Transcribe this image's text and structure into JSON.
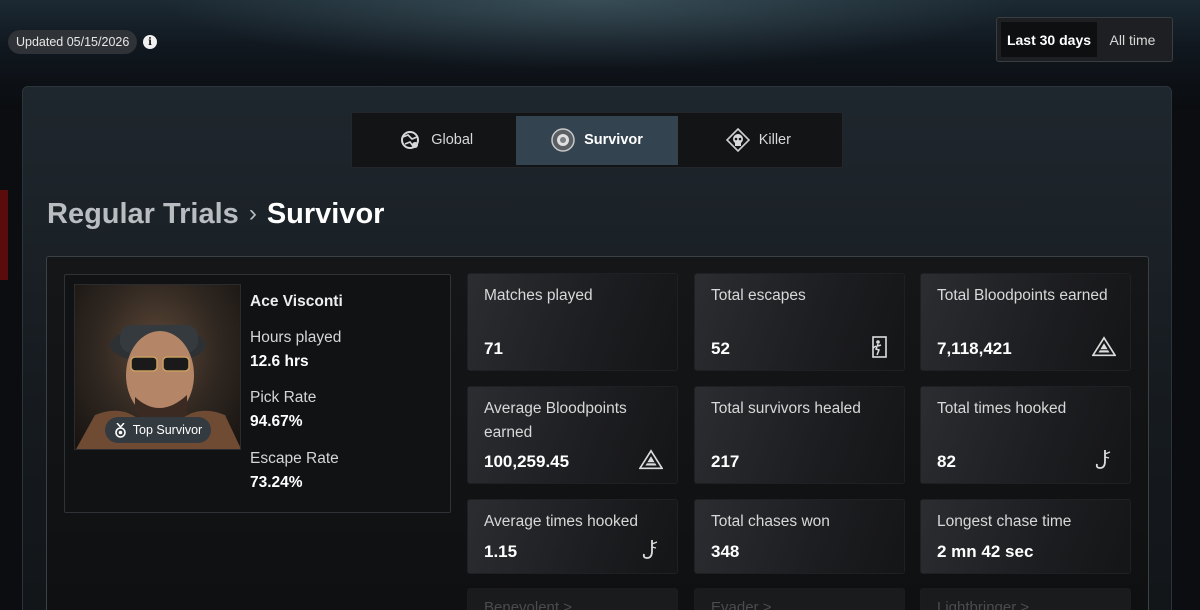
{
  "header": {
    "updated": "Updated 05/15/2026",
    "range": {
      "active": "Last 30 days",
      "inactive": "All time"
    }
  },
  "tabs": [
    {
      "label": "Global",
      "icon": "globe-map-icon"
    },
    {
      "label": "Survivor",
      "icon": "survivor-emblem-icon",
      "active": true
    },
    {
      "label": "Killer",
      "icon": "skull-icon"
    }
  ],
  "breadcrumb": {
    "parent": "Regular Trials",
    "separator": "›",
    "current": "Survivor"
  },
  "character": {
    "name": "Ace Visconti",
    "badge": "Top Survivor",
    "stats": [
      {
        "label": "Hours played",
        "value": "12.6 hrs"
      },
      {
        "label": "Pick Rate",
        "value": "94.67%"
      },
      {
        "label": "Escape Rate",
        "value": "73.24%"
      }
    ]
  },
  "stats": [
    {
      "label": "Matches played",
      "value": "71",
      "icon": ""
    },
    {
      "label": "Total escapes",
      "value": "52",
      "icon": "exit-door-icon"
    },
    {
      "label": "Total Bloodpoints earned",
      "value": "7,118,421",
      "icon": "bloodpoints-icon"
    },
    {
      "label": "Average Bloodpoints earned",
      "value": "100,259.45",
      "icon": "bloodpoints-icon"
    },
    {
      "label": "Total survivors healed",
      "value": "217",
      "icon": ""
    },
    {
      "label": "Total times hooked",
      "value": "82",
      "icon": "hook-icon"
    },
    {
      "label": "Average times hooked",
      "value": "1.15",
      "icon": "hook-icon"
    },
    {
      "label": "Total chases won",
      "value": "348",
      "icon": ""
    },
    {
      "label": "Longest chase time",
      "value": "2 mn 42 sec",
      "icon": ""
    }
  ],
  "achievements": [
    {
      "label": "Benevolent >"
    },
    {
      "label": "Evader >"
    },
    {
      "label": "Lightbringer >"
    }
  ]
}
